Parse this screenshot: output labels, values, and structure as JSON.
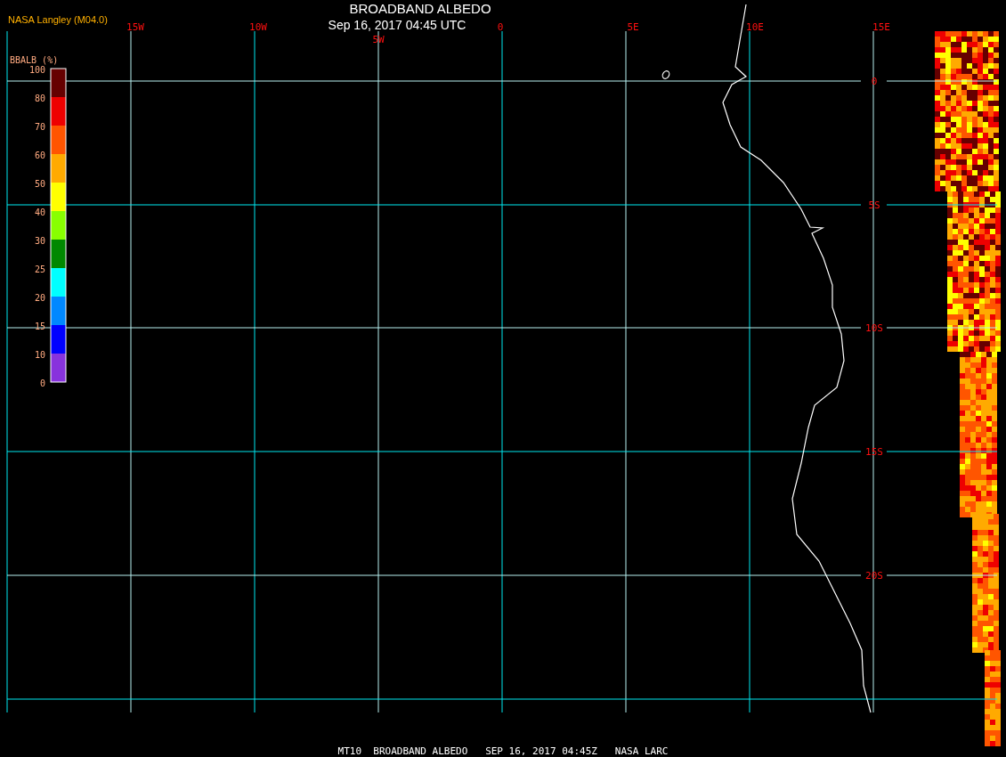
{
  "header": {
    "source": "NASA Langley (M04.0)",
    "title": "BROADBAND ALBEDO",
    "timestamp": "Sep 16, 2017 04:45 UTC"
  },
  "map": {
    "longitude_labels": [
      "15W",
      "10W",
      "5W",
      "0",
      "5E",
      "10E",
      "15E"
    ],
    "latitude_labels": [
      "0",
      "5S",
      "10S",
      "15S",
      "20S"
    ]
  },
  "legend": {
    "title": "BBALB (%)",
    "labels": [
      "100",
      "80",
      "70",
      "60",
      "50",
      "40",
      "30",
      "25",
      "20",
      "15",
      "10",
      "0"
    ],
    "colors": [
      {
        "color": "#660000"
      },
      {
        "color": "#ee0000"
      },
      {
        "color": "#ff5500"
      },
      {
        "color": "#ffaa00"
      },
      {
        "color": "#ffff00"
      },
      {
        "color": "#88ff00"
      },
      {
        "color": "#008800"
      },
      {
        "color": "#00ffff"
      },
      {
        "color": "#0088ff"
      },
      {
        "color": "#0000ff"
      },
      {
        "color": "#8833dd"
      }
    ]
  },
  "footer": "MT10  BROADBAND ALBEDO   SEP 16, 2017 04:45Z   NASA LARC"
}
